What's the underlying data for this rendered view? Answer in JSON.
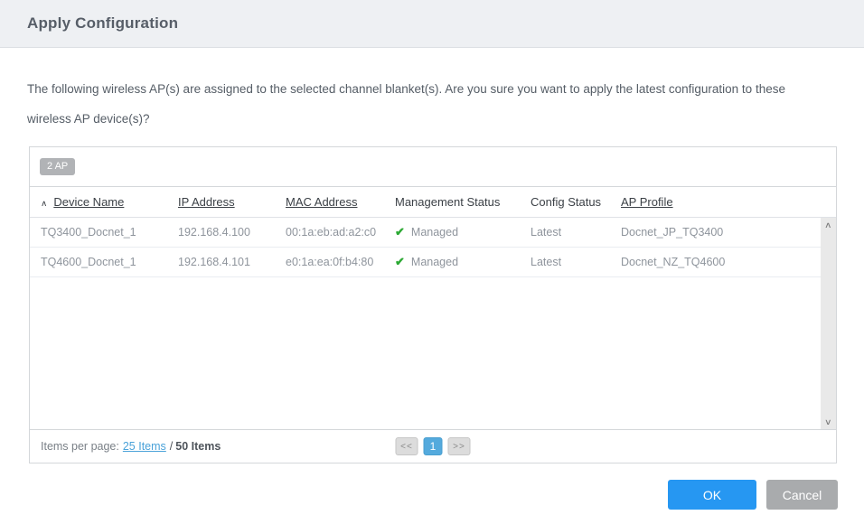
{
  "dialog": {
    "title": "Apply Configuration"
  },
  "message": "The following wireless AP(s) are assigned to the selected channel blanket(s). Are you sure you want to apply the latest configuration to these wireless AP device(s)?",
  "table": {
    "count_badge": "2 AP",
    "columns": [
      {
        "label": "Device Name",
        "sortable": true,
        "sorted": "asc"
      },
      {
        "label": "IP Address",
        "sortable": true
      },
      {
        "label": "MAC Address",
        "sortable": true
      },
      {
        "label": "Management Status",
        "sortable": false
      },
      {
        "label": "Config Status",
        "sortable": false
      },
      {
        "label": "AP Profile",
        "sortable": true
      }
    ],
    "rows": [
      {
        "device_name": "TQ3400_Docnet_1",
        "ip_address": "192.168.4.100",
        "mac_address": "00:1a:eb:ad:a2:c0",
        "management_status": "Managed",
        "config_status": "Latest",
        "ap_profile": "Docnet_JP_TQ3400"
      },
      {
        "device_name": "TQ4600_Docnet_1",
        "ip_address": "192.168.4.101",
        "mac_address": "e0:1a:ea:0f:b4:80",
        "management_status": "Managed",
        "config_status": "Latest",
        "ap_profile": "Docnet_NZ_TQ4600"
      }
    ]
  },
  "pagination": {
    "items_per_page_label": "Items per page:",
    "items_per_page_link": "25 Items",
    "separator": "/",
    "total_items": "50 Items",
    "prev_label": "<<",
    "current_page": "1",
    "next_label": ">>"
  },
  "footer": {
    "ok_label": "OK",
    "cancel_label": "Cancel"
  },
  "icons": {
    "sort_asc": "∧",
    "managed_check": "✔",
    "scroll_up": "∧",
    "scroll_down": "∨"
  },
  "colors": {
    "header_bg": "#eef0f3",
    "accent_blue": "#2697f2",
    "cancel_gray": "#a9abad",
    "link_blue": "#4aa2d9",
    "managed_green": "#2ca934",
    "pager_active_blue": "#54aadd",
    "badge_gray": "#b1b3b6"
  }
}
